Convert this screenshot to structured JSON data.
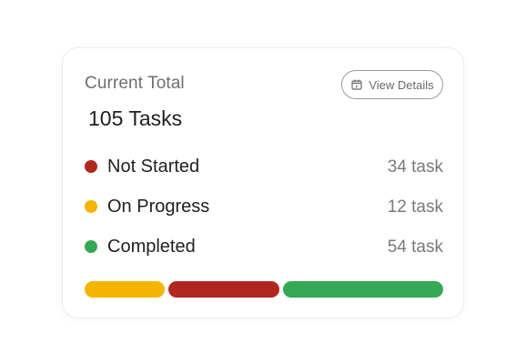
{
  "card": {
    "title": "Current Total",
    "total": "105 Tasks",
    "view_button": {
      "label": "View Details",
      "icon": "calendar-icon"
    },
    "statuses": [
      {
        "label": "Not Started",
        "count": "34 task",
        "color": "#b1271f"
      },
      {
        "label": "On Progress",
        "count": "12 task",
        "color": "#f4b400"
      },
      {
        "label": "Completed",
        "count": "54 task",
        "color": "#34a853"
      }
    ],
    "progress_bar": [
      {
        "color": "#f4b400"
      },
      {
        "color": "#b1271f"
      },
      {
        "color": "#34a853"
      }
    ]
  }
}
